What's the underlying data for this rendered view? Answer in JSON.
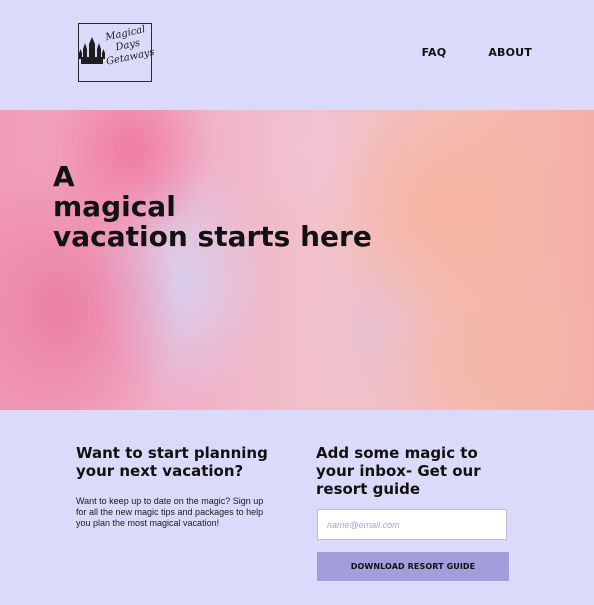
{
  "header": {
    "logo": {
      "lines": [
        "Magical",
        "Days",
        "Getaways"
      ],
      "icon": "castle-icon"
    },
    "nav": [
      {
        "label": "FAQ"
      },
      {
        "label": "ABOUT"
      }
    ]
  },
  "hero": {
    "title_lines": [
      "A",
      "magical",
      "vacation starts here"
    ]
  },
  "signup": {
    "left_heading": "Want to start planning your next vacation?",
    "left_text": "Want to keep up to date on the magic? Sign up for all the new magic tips and packages to help you plan the most magical vacation!",
    "right_heading": "Add some magic to your inbox- Get our resort guide",
    "email_placeholder": "name@email.com",
    "button_label": "DOWNLOAD RESORT GUIDE"
  },
  "colors": {
    "background": "#dcdafa",
    "button": "#a29edb",
    "text": "#111111"
  }
}
